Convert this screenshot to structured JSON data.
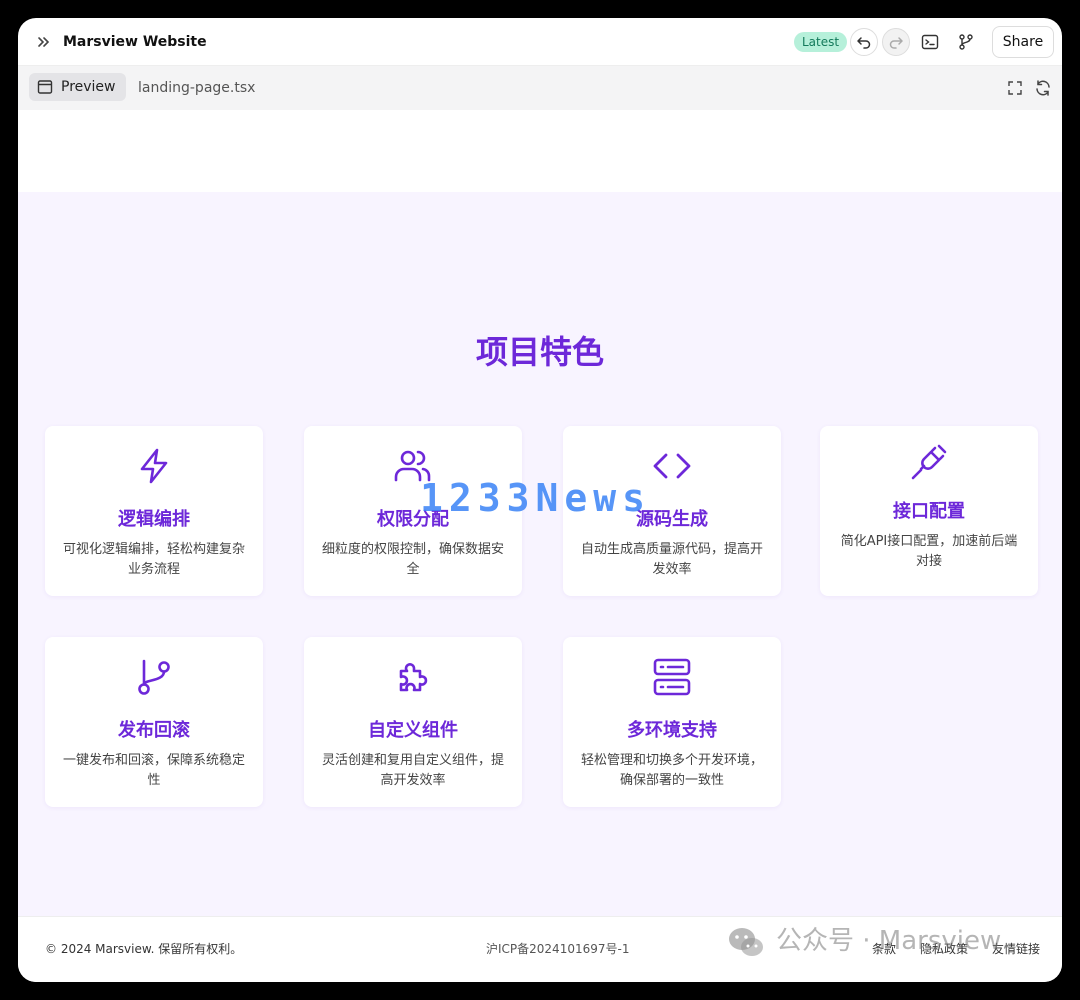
{
  "topbar": {
    "title": "Marsview Website",
    "badge": "Latest",
    "share_label": "Share"
  },
  "subbar": {
    "preview_label": "Preview",
    "file_label": "landing-page.tsx"
  },
  "features": {
    "title": "项目特色",
    "cards": [
      {
        "icon": "lightning-icon",
        "title": "逻辑编排",
        "desc": "可视化逻辑编排，轻松构建复杂业务流程"
      },
      {
        "icon": "users-icon",
        "title": "权限分配",
        "desc": "细粒度的权限控制，确保数据安全"
      },
      {
        "icon": "code-icon",
        "title": "源码生成",
        "desc": "自动生成高质量源代码，提高开发效率"
      },
      {
        "icon": "plug-icon",
        "title": "接口配置",
        "desc": "简化API接口配置，加速前后端对接"
      },
      {
        "icon": "git-branch-icon",
        "title": "发布回滚",
        "desc": "一键发布和回滚，保障系统稳定性"
      },
      {
        "icon": "puzzle-icon",
        "title": "自定义组件",
        "desc": "灵活创建和复用自定义组件，提高开发效率"
      },
      {
        "icon": "server-icon",
        "title": "多环境支持",
        "desc": "轻松管理和切换多个开发环境，确保部署的一致性"
      }
    ]
  },
  "footer": {
    "copyright": "© 2024 Marsview. 保留所有权利。",
    "icp": "沪ICP备2024101697号-1",
    "links": [
      "条款",
      "隐私政策",
      "友情链接"
    ]
  },
  "watermarks": {
    "news": "1233News",
    "wechat": "公众号 · Marsview"
  },
  "colors": {
    "accent": "#6d28d9",
    "section_bg": "#f8f4ff",
    "badge_bg": "#b6f0da"
  }
}
